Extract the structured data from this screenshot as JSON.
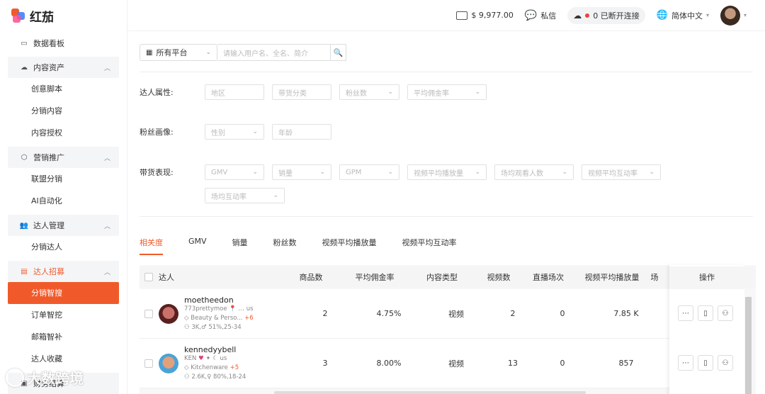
{
  "app": {
    "logo_text": "红茄"
  },
  "header": {
    "balance": "$ 9,977.00",
    "message_label": "私信",
    "connection_label": "0 已断开连接",
    "language_label": "简体中文"
  },
  "sidebar": {
    "dashboard": "数据看板",
    "groups": [
      {
        "label": "内容资产",
        "items": [
          "创意脚本",
          "分销内容",
          "内容授权"
        ]
      },
      {
        "label": "营销推广",
        "items": [
          "联盟分销",
          "AI自动化"
        ]
      },
      {
        "label": "达人管理",
        "items": [
          "分销达人"
        ]
      },
      {
        "label": "达人招募",
        "items": [
          "分销智搜",
          "订单智挖",
          "邮箱智补",
          "达人收藏"
        ]
      },
      {
        "label": "财务结算",
        "items": []
      }
    ],
    "active_item": "分销智搜"
  },
  "search": {
    "platform_select": "所有平台",
    "placeholder": "请输入用户名、全名、简介"
  },
  "filters": {
    "kol_attr_label": "达人属性:",
    "kol_attr": [
      "地区",
      "带货分类",
      "粉丝数",
      "平均佣金率"
    ],
    "fans_label": "粉丝画像:",
    "fans": [
      "性别",
      "年龄"
    ],
    "perf_label": "带货表现:",
    "perf": [
      "GMV",
      "销量",
      "GPM",
      "视频平均播放量",
      "场均观看人数",
      "视频平均互动率",
      "场均互动率"
    ]
  },
  "tabs": [
    "相关度",
    "GMV",
    "销量",
    "粉丝数",
    "视频平均播放量",
    "视频平均互动率"
  ],
  "table": {
    "headers": [
      "达人",
      "商品数",
      "平均佣金率",
      "内容类型",
      "视频数",
      "直播场次",
      "视频平均播放量",
      "场",
      "操作"
    ],
    "rows": [
      {
        "name": "moetheedon",
        "handle": "773prettymoe",
        "region": "us",
        "category": "Beauty & Perso...",
        "category_more": "+6",
        "fans": "3K,♂ 51%,25-34",
        "products": "2",
        "commission": "4.75%",
        "content_type": "视频",
        "videos": "2",
        "lives": "0",
        "avg_views": "7.85 K"
      },
      {
        "name": "kennedyybell",
        "handle": "KEN",
        "region": "us",
        "category": "Kitchenware",
        "category_more": "+5",
        "fans": "2.6K,♀ 80%,18-24",
        "products": "3",
        "commission": "8.00%",
        "content_type": "视频",
        "videos": "13",
        "lives": "0",
        "avg_views": "857"
      }
    ]
  },
  "watermark": "大数跨境",
  "colors": {
    "accent": "#f05a2b"
  }
}
